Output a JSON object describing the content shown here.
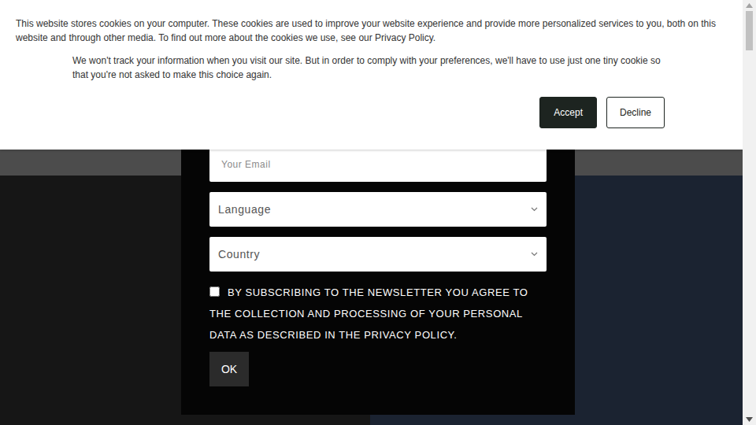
{
  "cookie_banner": {
    "text": "This website stores cookies on your computer. These cookies are used to improve your website experience and provide more personalized services to you, both on this website and through other media. To find out more about the cookies we use, see our Privacy Policy.",
    "secondary_text": "We won't track your information when you visit our site. But in order to comply with your preferences, we'll have to use just one tiny cookie so that you're not asked to make this choice again.",
    "buttons": [
      {
        "label": "Accept",
        "primary": true
      },
      {
        "label": "Decline",
        "primary": false
      }
    ]
  },
  "newsletter": {
    "email_placeholder": "Your Email",
    "selects": [
      {
        "placeholder": "Language"
      },
      {
        "placeholder": "Country"
      }
    ],
    "consent": {
      "text": "BY SUBSCRIBING TO THE NEWSLETTER YOU AGREE TO THE COLLECTION AND PROCESSING OF YOUR PERSONAL DATA AS DESCRIBED IN THE PRIVACY POLICY.",
      "checked": false
    },
    "submit": "OK"
  }
}
